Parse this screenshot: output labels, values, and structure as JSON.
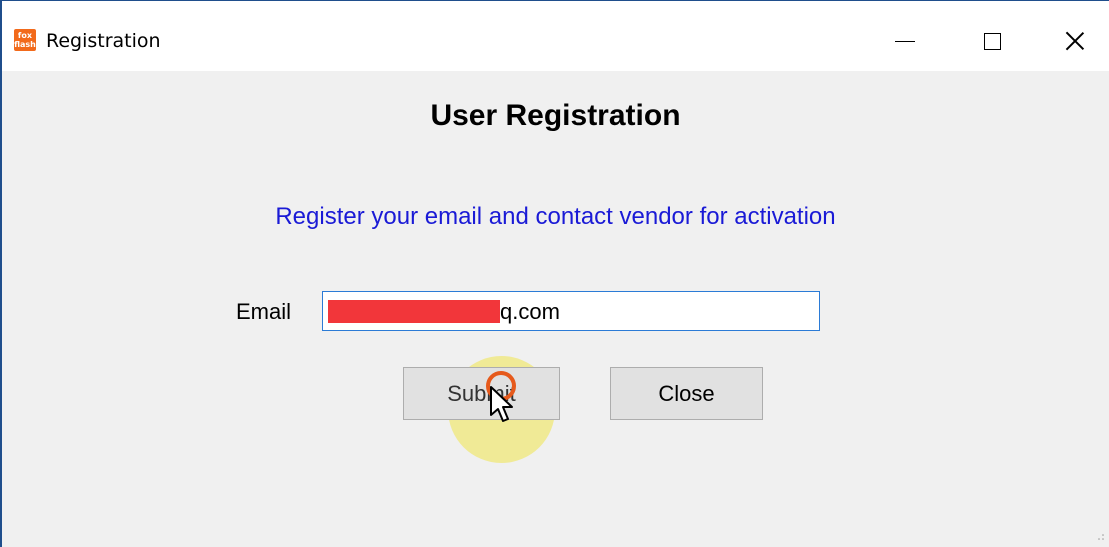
{
  "window": {
    "title": "Registration",
    "app_icon_text": "fox\nflash"
  },
  "form": {
    "heading": "User Registration",
    "subtitle": "Register your email and contact vendor for activation",
    "email_label": "Email",
    "email_value_visible": "q.com"
  },
  "buttons": {
    "submit": "Submit",
    "close": "Close"
  },
  "colors": {
    "subtitle": "#1a1ad6",
    "input_border": "#2b7bd6",
    "redaction": "#f2363a",
    "app_icon": "#f26a1b"
  },
  "icons": {
    "app": "foxflash-app-icon",
    "minimize": "minimize-icon",
    "maximize": "maximize-icon",
    "close": "close-icon",
    "cursor": "mouse-pointer-icon"
  }
}
